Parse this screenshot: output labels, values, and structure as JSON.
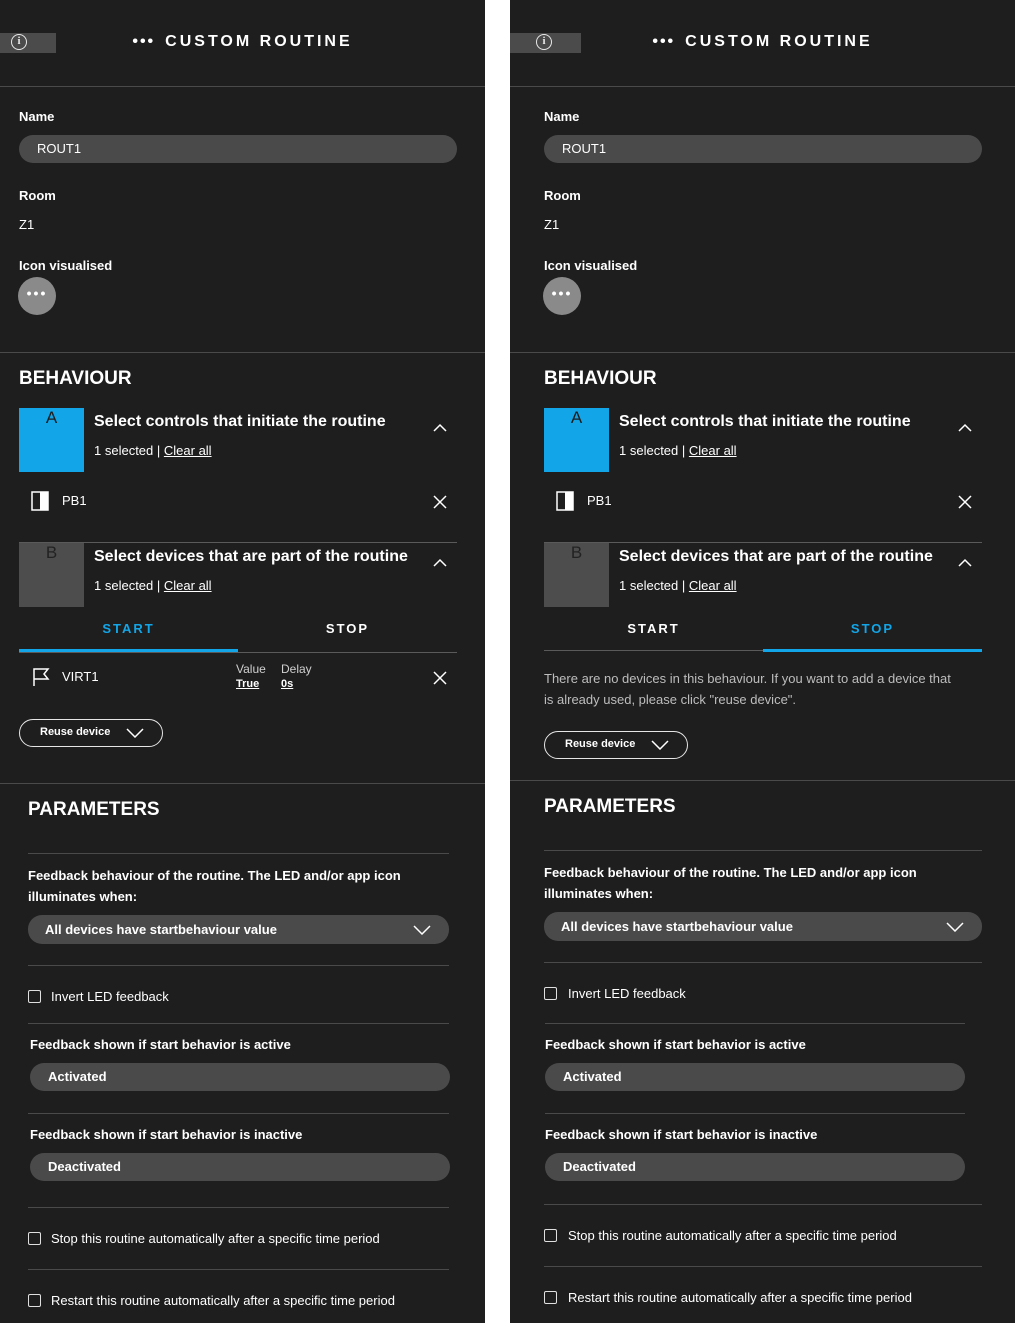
{
  "header": {
    "title": "CUSTOM ROUTINE",
    "dots": "•••"
  },
  "form": {
    "name_label": "Name",
    "name_value": "ROUT1",
    "room_label": "Room",
    "room_value": "Z1",
    "icon_label": "Icon visualised",
    "icon_glyph": "•••"
  },
  "behaviour": {
    "title": "BEHAVIOUR",
    "card_a": {
      "badge": "A",
      "title": "Select controls that initiate the routine",
      "selected": "1 selected |",
      "clear": "Clear all"
    },
    "control_item": {
      "name": "PB1"
    },
    "card_b": {
      "badge": "B",
      "title": "Select devices that are part of the routine",
      "selected": "1 selected |",
      "clear": "Clear all"
    },
    "tabs": {
      "start": "START",
      "stop": "STOP"
    },
    "device_item": {
      "name": "VIRT1",
      "value_label": "Value",
      "value": "True",
      "delay_label": "Delay",
      "delay": "0s"
    },
    "empty_message_line1": "There are no devices in this behaviour. If you want to add a device that",
    "empty_message_line2": "is already used, please click \"reuse device\".",
    "reuse_label": "Reuse device"
  },
  "parameters": {
    "title": "PARAMETERS",
    "feedback_label_line1": "Feedback behaviour of the routine. The LED and/or app icon",
    "feedback_label_line2": "illuminates when:",
    "feedback_value": "All devices have startbehaviour value",
    "invert_label": "Invert LED feedback",
    "active_label": "Feedback shown if start behavior is active",
    "active_value": "Activated",
    "inactive_label": "Feedback shown if start behavior is inactive",
    "inactive_value": "Deactivated",
    "stop_label": "Stop this routine automatically after a specific time period",
    "restart_label": "Restart this routine automatically after a specific time period"
  },
  "colors": {
    "accent": "#12a6e8",
    "panel_bg": "#1e1e1f",
    "field_bg": "#4a4a4a"
  },
  "icons": [
    "info-icon",
    "dots-icon",
    "chevron-up-icon",
    "close-icon",
    "pushbutton-icon",
    "flag-icon",
    "chevron-down-icon",
    "checkbox-icon"
  ]
}
